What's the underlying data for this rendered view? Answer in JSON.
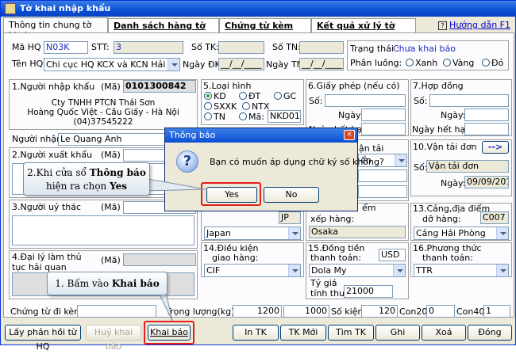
{
  "window": {
    "title": "Tờ khai nhập khẩu"
  },
  "tabs": [
    {
      "label": "Thông tin chung tờ khai"
    },
    {
      "label": "Danh sách hàng tờ khai"
    },
    {
      "label": "Chứng từ kèm theo"
    },
    {
      "label": "Kết quả xử lý tờ khai"
    }
  ],
  "help": {
    "label": "Hướng dẫn F1",
    "icon": "question-icon"
  },
  "header": {
    "ma_hq_label": "Mã HQ",
    "ma_hq": "N03K",
    "stt_label": "STT:",
    "stt": "3",
    "so_tk_label": "Số TK:",
    "so_tk": "",
    "so_tn_label": "Số TN:",
    "so_tn": "",
    "trang_thai_label": "Trạng thái :",
    "trang_thai": "Chưa khai báo",
    "ten_hq_label": "Tên HQ",
    "ten_hq": "Chi cục HQ KCX và KCN Hải Phòn",
    "ngay_dk_label": "Ngày ĐK:",
    "ngay_dk": "__/__/____",
    "ngay_tn_label": "Ngày TN:",
    "ngay_tn": "__/__/____",
    "phan_luong_label": "Phân luồng:",
    "luong": [
      "Xanh",
      "Vàng",
      "Đỏ"
    ]
  },
  "importer": {
    "label": "1.Người nhập khẩu",
    "ma_label": "(Mã)",
    "ma": "0101300842",
    "lines": [
      "Cty TNHH PTCN Thái Sơn",
      "Hoàng Quốc Việt - Cầu Giấy - Hà Nội",
      "(04)37545222"
    ],
    "nguoi_nhan_label": "Người nhận:",
    "nguoi_nhan": "Le Quang Anh"
  },
  "exporter": {
    "label": "2.Người xuất khẩu",
    "ma_label": "(Mã)"
  },
  "trustee": {
    "label": "3.Người uỷ thác",
    "ma_label": "(Mã)"
  },
  "agent": {
    "label": "4.Đại lý làm thủ tục hải quan",
    "ma_label": "(Mã)"
  },
  "loai_hinh": {
    "label": "5.Loại hình",
    "options": [
      "KD",
      "ĐT",
      "GC",
      "SXXK",
      "NTX",
      "TN",
      "Mã:"
    ],
    "selected": "KD",
    "ma": "NKD01"
  },
  "giay_phep": {
    "label": "6.Giấy phép (nếu có)",
    "so_label": "Số:",
    "ngay_label": "Ngày:",
    "ngay_het_han_label": "Ngày hết hạn:"
  },
  "hop_dong": {
    "label": "7.Hợp đồng",
    "so_label": "Số:",
    "ngay_label": "Ngày:",
    "ngay_het_han_label": "Ngày hết hạn:"
  },
  "van_tai": {
    "label_fragment": "ận tải",
    "value_fragment": "ển"
  },
  "van_tai_don": {
    "label": "10.Vận tải đơn",
    "so_label": "Số:",
    "so": "Vận tải đơn",
    "ngay_label": "Ngày:",
    "ngay": "09/09/2011",
    "arrow": "-->"
  },
  "nuoc_xuat": {
    "code": "JP",
    "value": "Japan"
  },
  "cang_xep": {
    "label": "xếp hàng:",
    "value": "Osaka",
    "label_fragment": "ểm"
  },
  "cang_do": {
    "label1": "13.Cảng,địa điểm",
    "label2": "dỡ hàng:",
    "code": "C007",
    "value": "Cảng Hải Phòng"
  },
  "dieu_kien": {
    "label1": "14.Điều kiện",
    "label2": "giao hàng:",
    "value": "CIF"
  },
  "dong_tien": {
    "label1": "15.Đồng tiền",
    "label2": "thanh toán:",
    "code": "USD",
    "value": "Dola My",
    "ty_gia_label1": "Tỷ giá",
    "ty_gia_label2": "tính thuế:",
    "ty_gia": "21000"
  },
  "phuong_thuc": {
    "label1": "16.Phương thức",
    "label2": "thanh toán:",
    "value": "TTR"
  },
  "footer": {
    "chung_tu_label": "Chứng từ đi kèm:",
    "trong_luong_label": "Trọng lượng(kg):",
    "trong_luong": "1200",
    "trong_luong2": "1000",
    "so_kien_label": "Số kiện:",
    "so_kien": "120",
    "con20_label": "Con20:",
    "con20": "0",
    "con40_label": "Con40:",
    "con40": "1"
  },
  "buttons": {
    "lay_phan_hoi": "Lấy phản hồi từ HQ",
    "huy_khai_bao": "Huỷ khai báo",
    "khai_bao": "Khai báo",
    "in_tk": "In TK",
    "tk_moi": "TK Mới",
    "tim_tk": "Tìm TK",
    "ghi": "Ghi",
    "xoa": "Xoá",
    "dong": "Đóng"
  },
  "dialog": {
    "title": "Thông báo",
    "message": "Bạn có muốn áp dụng chữ ký số không?",
    "yes": "Yes",
    "no": "No",
    "close": "×",
    "icon": "question-icon"
  },
  "callouts": {
    "step2_line1_prefix": "2.Khi cửa sổ ",
    "step2_line1_bold": "Thông báo",
    "step2_line2_prefix": "hiện ra chọn ",
    "step2_line2_bold": "Yes",
    "step1_prefix": "1. Bấm vào ",
    "step1_bold": "Khai báo"
  }
}
